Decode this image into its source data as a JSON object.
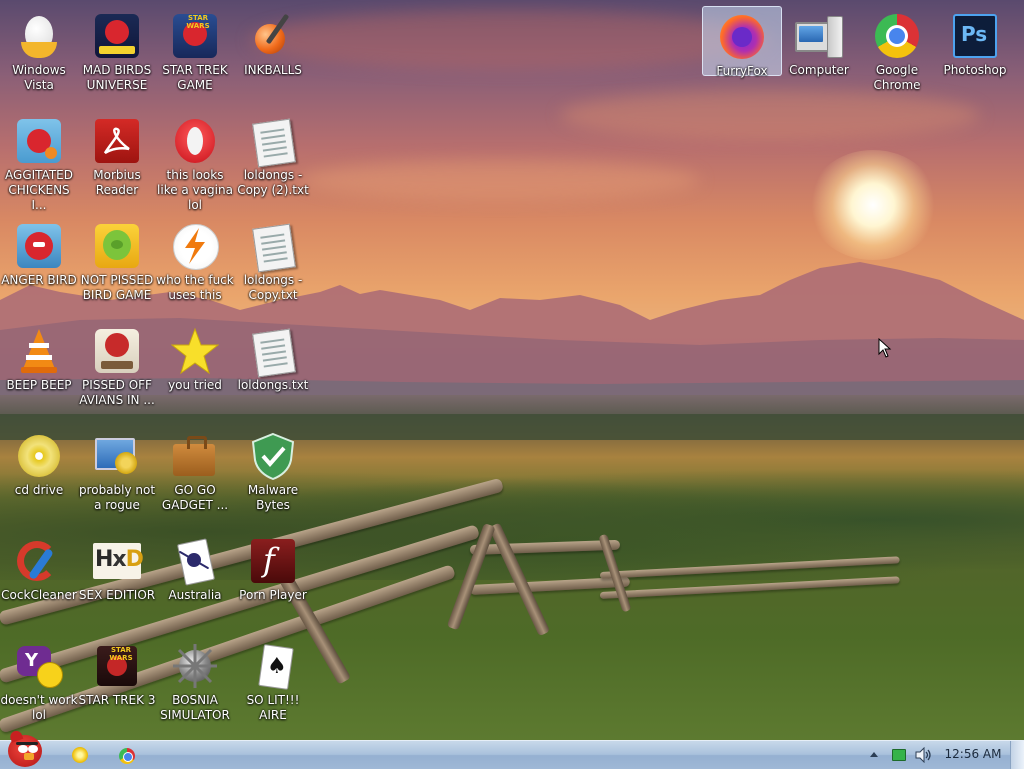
{
  "desktop": {
    "icons": [
      {
        "label": "Windows Vista",
        "icon": "windows-vista-egg-icon"
      },
      {
        "label": "MAD BIRDS UNIVERSE",
        "icon": "angry-birds-space-icon"
      },
      {
        "label": "STAR TREK GAME",
        "icon": "angry-birds-star-wars-icon"
      },
      {
        "label": "INKBALLS",
        "icon": "inkball-icon"
      },
      {
        "label": "AGGITATED CHICKENS I...",
        "icon": "angry-birds-icon"
      },
      {
        "label": "Morbius Reader",
        "icon": "acrobat-reader-icon"
      },
      {
        "label": "this looks like a vagina lol",
        "icon": "opera-icon"
      },
      {
        "label": "loldongs - Copy (2).txt",
        "icon": "text-file-icon"
      },
      {
        "label": "ANGER BIRD",
        "icon": "angry-bird-icon"
      },
      {
        "label": "NOT PISSED BIRD GAME",
        "icon": "bad-piggies-icon"
      },
      {
        "label": "who the fuck uses this",
        "icon": "avast-icon"
      },
      {
        "label": "loldongs - Copy.txt",
        "icon": "text-file-icon"
      },
      {
        "label": "BEEP BEEP",
        "icon": "vlc-cone-icon"
      },
      {
        "label": "PISSED OFF AVIANS IN ...",
        "icon": "angry-birds-seasons-icon"
      },
      {
        "label": "you tried",
        "icon": "star-icon"
      },
      {
        "label": "loldongs.txt",
        "icon": "text-file-icon"
      },
      {
        "label": "cd drive",
        "icon": "cd-drive-icon"
      },
      {
        "label": "probably not a rogue",
        "icon": "computer-settings-icon"
      },
      {
        "label": "GO GO GADGET ...",
        "icon": "briefcase-icon"
      },
      {
        "label": "Malware Bytes",
        "icon": "shield-check-icon"
      },
      {
        "label": "CockCleaner",
        "icon": "ccleaner-icon"
      },
      {
        "label": "SEX EDITIOR",
        "icon": "hxd-editor-icon"
      },
      {
        "label": "Australia",
        "icon": "spider-solitaire-icon"
      },
      {
        "label": "Porn Player",
        "icon": "flash-player-icon"
      },
      {
        "label": "doesn't work lol",
        "icon": "yahoo-messenger-icon"
      },
      {
        "label": "STAR TREK 3",
        "icon": "star-wars-game-icon"
      },
      {
        "label": "BOSNIA SIMULATOR",
        "icon": "minesweeper-icon"
      },
      {
        "label": "SO LIT!!! AIRE",
        "icon": "solitaire-icon"
      },
      {
        "label": "FurryFox",
        "icon": "firefox-icon"
      },
      {
        "label": "Computer",
        "icon": "computer-icon"
      },
      {
        "label": "Google Chrome",
        "icon": "chrome-icon"
      },
      {
        "label": "Photoshop",
        "icon": "photoshop-icon"
      }
    ]
  },
  "taskbar": {
    "start_icon": "angry-bird-start-icon",
    "pinned": [
      {
        "icon": "windows-explorer-icon"
      },
      {
        "icon": "chrome-icon"
      }
    ],
    "tray": {
      "arrow_icon": "tray-expand-icon",
      "power_icon": "power-battery-icon",
      "volume_icon": "volume-icon"
    },
    "clock": "12:56 AM"
  },
  "colors": {
    "taskbar": "#a9c1dc",
    "label_text": "#ffffff",
    "selection": "#c8dcf5"
  }
}
